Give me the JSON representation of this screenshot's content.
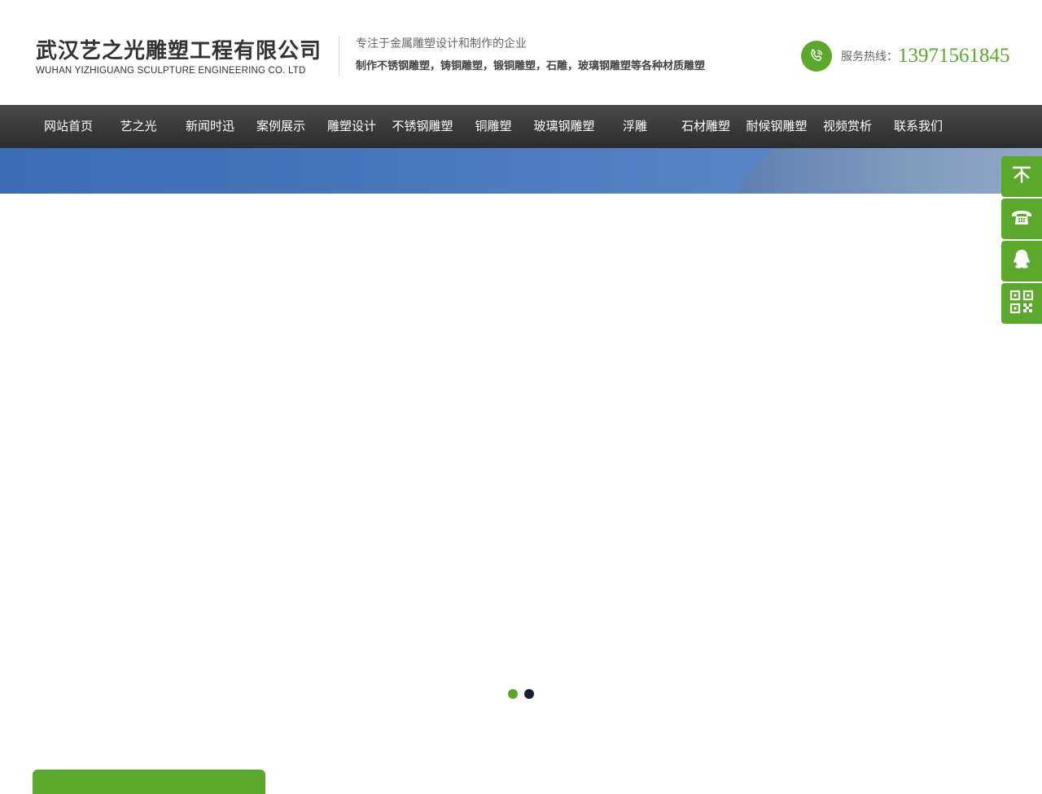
{
  "header": {
    "logo_cn": "武汉艺之光雕塑工程有限公司",
    "logo_en": "WUHAN YIZHIGUANG SCULPTURE ENGINEERING CO. LTD",
    "slogan_line1": "专注于金属雕塑设计和制作的企业",
    "slogan_line2": "制作不锈钢雕塑，铸铜雕塑，锻铜雕塑，石雕，玻璃钢雕塑等各种材质雕塑",
    "hotline_label": "服务热线：",
    "hotline_number": "13971561845"
  },
  "nav": {
    "items": [
      {
        "label": "网站首页"
      },
      {
        "label": "艺之光"
      },
      {
        "label": "新闻时迅"
      },
      {
        "label": "案例展示"
      },
      {
        "label": "雕塑设计"
      },
      {
        "label": "不锈钢雕塑"
      },
      {
        "label": "铜雕塑"
      },
      {
        "label": "玻璃钢雕塑"
      },
      {
        "label": "浮雕"
      },
      {
        "label": "石材雕塑"
      },
      {
        "label": "耐候钢雕塑"
      },
      {
        "label": "视频赏析"
      },
      {
        "label": "联系我们"
      }
    ]
  },
  "slider": {
    "slide_count": 2,
    "active_index": 0
  },
  "side_toolbar": {
    "icons": [
      "back-to-top-icon",
      "telephone-icon",
      "qq-icon",
      "qr-code-icon"
    ]
  },
  "colors": {
    "accent": "#5ba82c",
    "nav_bg": "#3a3a3a",
    "dot_inactive": "#172033"
  }
}
